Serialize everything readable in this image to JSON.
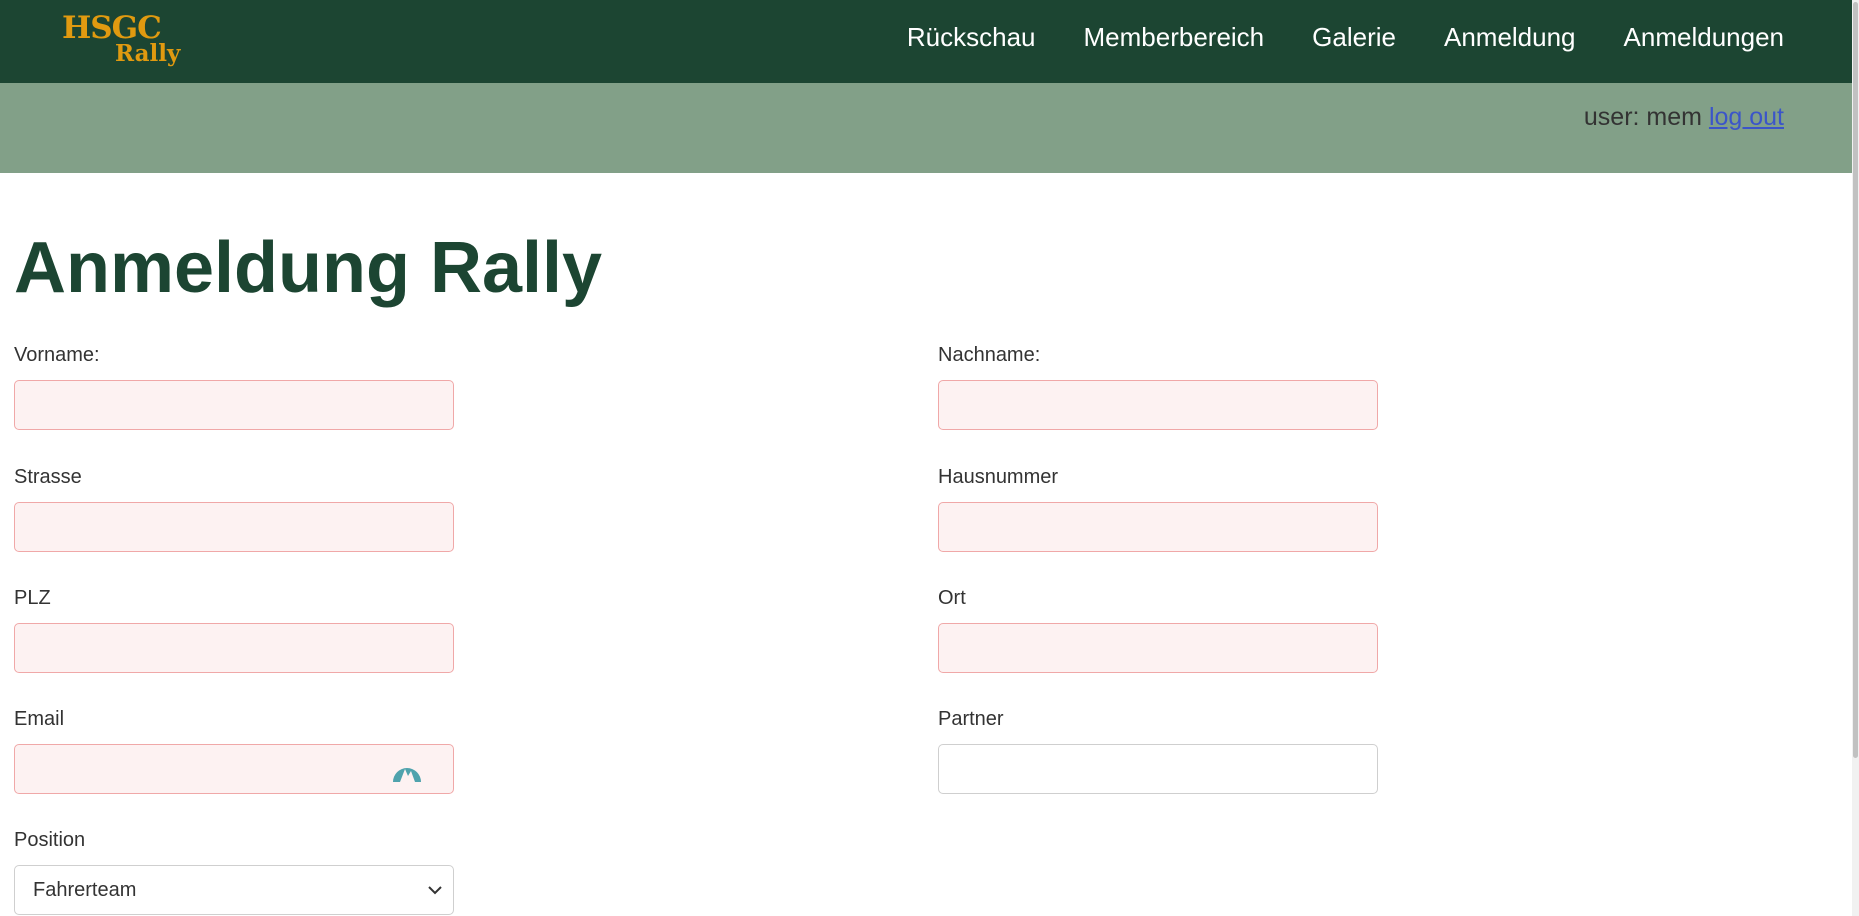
{
  "logo": {
    "line1": "HSGC",
    "line2": "Rally"
  },
  "nav": {
    "items": [
      "Rückschau",
      "Memberbereich",
      "Galerie",
      "Anmeldung",
      "Anmeldungen"
    ]
  },
  "user_bar": {
    "user_label": "user: mem",
    "logout_label": "log out"
  },
  "page": {
    "title": "Anmeldung Rally"
  },
  "form": {
    "vorname": {
      "label": "Vorname:",
      "value": ""
    },
    "nachname": {
      "label": "Nachname:",
      "value": ""
    },
    "strasse": {
      "label": "Strasse",
      "value": ""
    },
    "hausnummer": {
      "label": "Hausnummer",
      "value": ""
    },
    "plz": {
      "label": "PLZ",
      "value": ""
    },
    "ort": {
      "label": "Ort",
      "value": ""
    },
    "email": {
      "label": "Email",
      "value": ""
    },
    "partner": {
      "label": "Partner",
      "value": ""
    },
    "position": {
      "label": "Position",
      "selected": "Fahrerteam"
    }
  },
  "colors": {
    "nav_bg": "#1c4532",
    "subbar_bg": "#82a088",
    "logo": "#e09a10",
    "title": "#1c4532",
    "invalid_border": "#f0a8a8",
    "invalid_bg": "#fdf2f2",
    "link": "#3b55c9"
  },
  "icons": {
    "email_field": "mountain-peak-icon",
    "select": "chevron-down-icon"
  }
}
